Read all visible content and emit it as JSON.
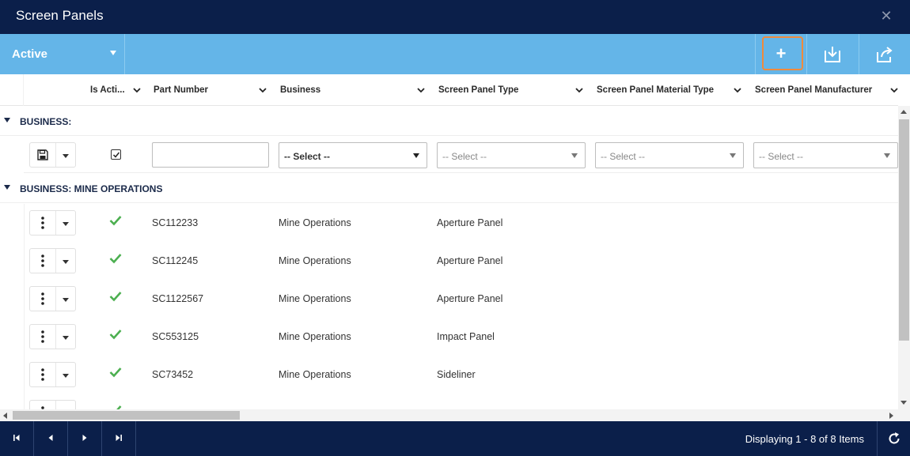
{
  "window": {
    "title": "Screen Panels",
    "close_label": "✕"
  },
  "toolbar": {
    "filter_value": "Active",
    "add_label": "+"
  },
  "columns": [
    {
      "label": "Is Acti..."
    },
    {
      "label": "Part Number"
    },
    {
      "label": "Business"
    },
    {
      "label": "Screen Panel Type"
    },
    {
      "label": "Screen Panel Material Type"
    },
    {
      "label": "Screen Panel Manufacturer"
    }
  ],
  "groups": [
    {
      "label": "BUSINESS:"
    },
    {
      "label": "BUSINESS: MINE OPERATIONS"
    }
  ],
  "edit_row": {
    "part_number_value": "",
    "business_select": "-- Select --",
    "type_select": "-- Select --",
    "material_select": "-- Select --",
    "manufacturer_select": "-- Select --"
  },
  "rows": [
    {
      "part_number": "SC112233",
      "business": "Mine Operations",
      "type": "Aperture Panel"
    },
    {
      "part_number": "SC112245",
      "business": "Mine Operations",
      "type": "Aperture Panel"
    },
    {
      "part_number": "SC1122567",
      "business": "Mine Operations",
      "type": "Aperture Panel"
    },
    {
      "part_number": "SC553125",
      "business": "Mine Operations",
      "type": "Impact Panel"
    },
    {
      "part_number": "SC73452",
      "business": "Mine Operations",
      "type": "Sideliner"
    }
  ],
  "footer": {
    "display_info": "Displaying 1 - 8 of 8 Items"
  },
  "colors": {
    "title_bg": "#0b1f4a",
    "toolbar_bg": "#64b5e8",
    "add_highlight": "#f08a3c",
    "check_green": "#4caf50"
  }
}
